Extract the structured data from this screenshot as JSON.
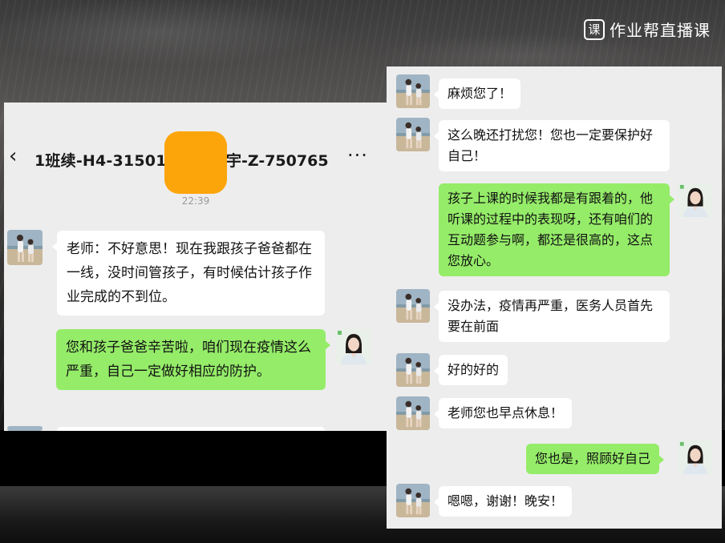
{
  "brand": {
    "badge": "课",
    "name": "作业帮直播课"
  },
  "left_chat": {
    "title": "1班续-H4-315013",
    "title_suffix": "宇-Z-750765",
    "more": "···",
    "timestamp": "22:39",
    "messages": [
      {
        "side": "left",
        "text": "老师：不好意思！现在我跟孩子爸爸都在一线，没时间管孩子，有时候估计孩子作业完成的不到位。"
      },
      {
        "side": "right",
        "text": "您和孩子爸爸辛苦啦，咱们现在疫情这么严重，自己一定做好相应的防护。"
      }
    ]
  },
  "right_chat": {
    "messages": [
      {
        "side": "left",
        "text": "麻烦您了！"
      },
      {
        "side": "left",
        "text": "这么晚还打扰您！您也一定要保护好自己！"
      },
      {
        "side": "right",
        "text": "孩子上课的时候我都是有跟着的，他听课的过程中的表现呀，还有咱们的互动题参与啊，都还是很高的，这点您放心。"
      },
      {
        "side": "left",
        "text": "没办法，疫情再严重，医务人员首先要在前面"
      },
      {
        "side": "left",
        "text": "好的好的"
      },
      {
        "side": "left",
        "text": "老师您也早点休息！"
      },
      {
        "side": "right",
        "text": "您也是，照顾好自己"
      },
      {
        "side": "left",
        "text": "嗯嗯，谢谢！晚安！"
      }
    ]
  },
  "colors": {
    "my_bubble": "#95ec69",
    "their_bubble": "#ffffff",
    "chat_bg": "#ededed",
    "redaction": "#fca50a"
  }
}
